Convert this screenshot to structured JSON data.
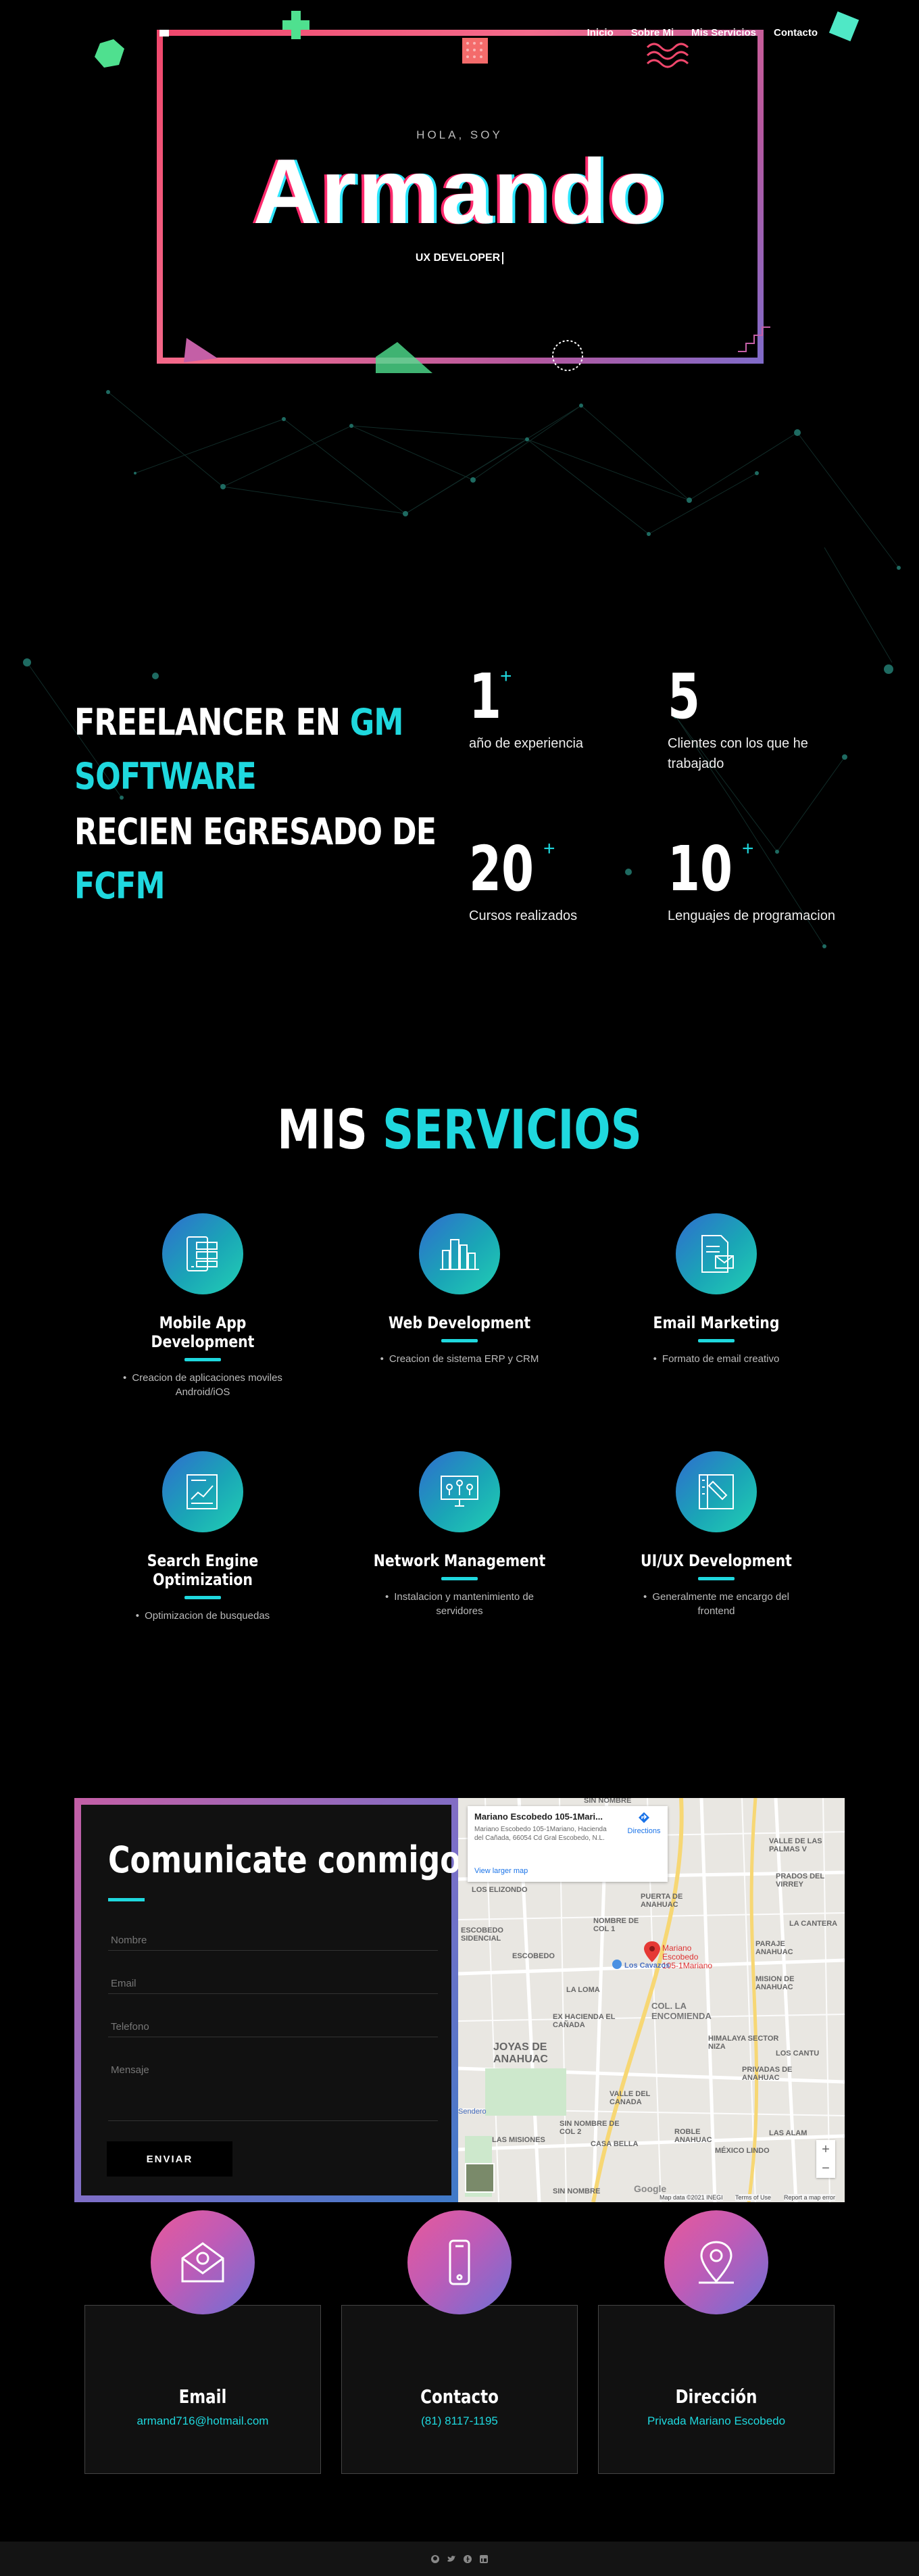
{
  "nav": {
    "items": [
      "Inicio",
      "Sobre Mi",
      "Mis Servicios",
      "Contacto"
    ]
  },
  "hero": {
    "kicker": "HOLA, SOY",
    "name": "Armando",
    "role": "UX DEVELOPER"
  },
  "about": {
    "line1_a": "FREELANCER EN ",
    "line1_b": "GM",
    "line2": "SOFTWARE",
    "line3": "RECIEN EGRESADO DE",
    "line4": "FCFM",
    "stats": [
      {
        "num": "1",
        "plus": "+",
        "label": "año de experiencia"
      },
      {
        "num": "5",
        "plus": "",
        "label": "Clientes con los que he trabajado"
      },
      {
        "num": "20",
        "plus": "+",
        "label": "Cursos realizados"
      },
      {
        "num": "10",
        "plus": "+",
        "label": "Lenguajes de programacion"
      }
    ]
  },
  "services": {
    "title_a": "MIS ",
    "title_b": "SERVICIOS",
    "items": [
      {
        "title": "Mobile App Development",
        "desc": "Creacion de aplicaciones moviles Android/iOS",
        "icon": "mobile-app-icon"
      },
      {
        "title": "Web Development",
        "desc": "Creacion de sistema ERP y CRM",
        "icon": "web-dev-icon"
      },
      {
        "title": "Email Marketing",
        "desc": "Formato de email creativo",
        "icon": "email-marketing-icon"
      },
      {
        "title": "Search Engine Optimization",
        "desc": "Optimizacion de busquedas",
        "icon": "seo-icon"
      },
      {
        "title": "Network Management",
        "desc": "Instalacion y mantenimiento de servidores",
        "icon": "network-icon"
      },
      {
        "title": "UI/UX Development",
        "desc": "Generalmente me encargo del frontend",
        "icon": "uiux-icon"
      }
    ]
  },
  "contact": {
    "title": "Comunicate conmigo",
    "fields": {
      "name": "Nombre",
      "email": "Email",
      "phone": "Telefono",
      "message": "Mensaje"
    },
    "send": "ENVIAR",
    "map": {
      "place": "Mariano Escobedo 105-1Mari...",
      "address": "Mariano Escobedo 105-1Mariano, Hacienda del Cañada, 66054 Cd Gral Escobedo, N.L.",
      "directions": "Directions",
      "larger": "View larger map",
      "pin_label": "Mariano Escobedo 105-1Mariano",
      "labels": [
        "SIN NOMBRE",
        "LOS ELIZONDO",
        "PUERTA DE ANAHUAC",
        "VALLE DE LAS PALMAS V",
        "PRADOS DEL VIRREY",
        "ESCOBEDO SIDENCIAL",
        "NOMBRE DE COL 1",
        "Los Cavazos",
        "LA LOMA",
        "COL. LA ENCOMIENDA",
        "PARAJE ANAHUAC",
        "MISION DE ANAHUAC",
        "EX HACIENDA EL CAÑADA",
        "HIMALAYA SECTOR NIZA",
        "JOYAS DE ANAHUAC",
        "VALLE DEL CANADA",
        "PRIVADAS DE ANAHUAC",
        "LAS MISIONES",
        "CASA BELLA",
        "ROBLE ANAHUAC",
        "LAS ALAM",
        "MÉXICO LINDO",
        "SIN NOMBRE DE COL 2",
        "SIN NOMBRE",
        "Sendero",
        "Google",
        "Map data ©2021 INEGI",
        "Terms of Use",
        "Report a map error",
        "LA CANTERA",
        "LOS CANTU",
        "ESCOBEDO"
      ]
    }
  },
  "cards": [
    {
      "title": "Email",
      "value": "armand716@hotmail.com",
      "icon": "email-icon"
    },
    {
      "title": "Contacto",
      "value": "(81) 8117-1195",
      "icon": "phone-icon"
    },
    {
      "title": "Dirección",
      "value": "Privada Mariano Escobedo",
      "icon": "location-pin-icon"
    }
  ],
  "colors": {
    "accent": "#1fd8de",
    "hero_border_start": "#f0476c",
    "hero_border_end": "#7f6bc9",
    "service_icon_gradient": "#2f6ccf",
    "card_icon_gradient": "#e85a9a"
  },
  "footer": {
    "icons": [
      "github-icon",
      "twitter-icon",
      "facebook-icon",
      "linkedin-icon"
    ]
  }
}
